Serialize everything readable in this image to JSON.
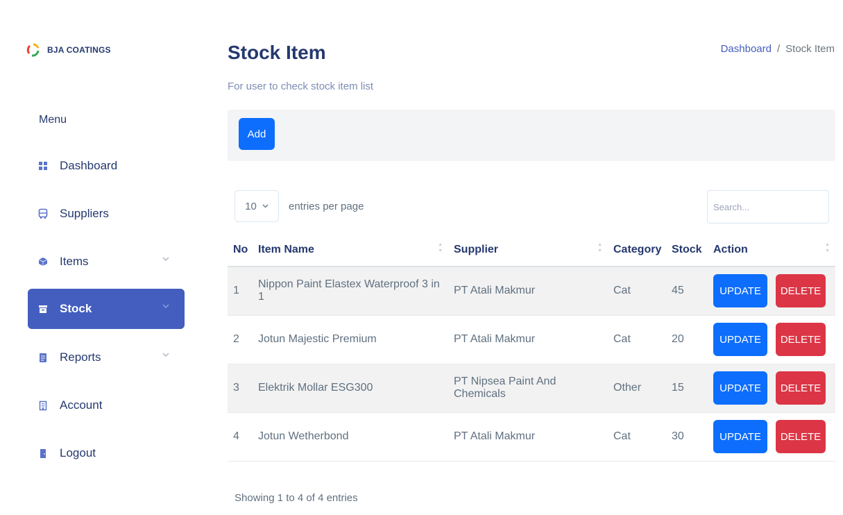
{
  "brand": {
    "name": "BJA COATINGS"
  },
  "sidebar": {
    "menu_title": "Menu",
    "items": [
      {
        "label": "Dashboard",
        "icon": "grid-icon",
        "has_submenu": false,
        "active": false
      },
      {
        "label": "Suppliers",
        "icon": "bus-icon",
        "has_submenu": false,
        "active": false
      },
      {
        "label": "Items",
        "icon": "box-icon",
        "has_submenu": true,
        "active": false
      },
      {
        "label": "Stock",
        "icon": "archive-icon",
        "has_submenu": true,
        "active": true
      },
      {
        "label": "Reports",
        "icon": "file-icon",
        "has_submenu": true,
        "active": false
      },
      {
        "label": "Account",
        "icon": "building-icon",
        "has_submenu": false,
        "active": false
      },
      {
        "label": "Logout",
        "icon": "door-icon",
        "has_submenu": false,
        "active": false
      }
    ]
  },
  "header": {
    "title": "Stock Item",
    "subtitle": "For user to check stock item list",
    "breadcrumb": {
      "link": "Dashboard",
      "separator": "/",
      "current": "Stock Item"
    }
  },
  "toolbar": {
    "add_label": "Add"
  },
  "table_controls": {
    "per_page_value": "10",
    "per_page_label": "entries per page",
    "search_placeholder": "Search..."
  },
  "table": {
    "columns": [
      "No",
      "Item Name",
      "Supplier",
      "Category",
      "Stock",
      "Action"
    ],
    "rows": [
      {
        "no": "1",
        "item_name": "Nippon Paint Elastex Waterproof 3 in 1",
        "supplier": "PT Atali Makmur",
        "category": "Cat",
        "stock": "45"
      },
      {
        "no": "2",
        "item_name": "Jotun Majestic Premium",
        "supplier": "PT Atali Makmur",
        "category": "Cat",
        "stock": "20"
      },
      {
        "no": "3",
        "item_name": "Elektrik Mollar ESG300",
        "supplier": "PT Nipsea Paint And Chemicals",
        "category": "Other",
        "stock": "15"
      },
      {
        "no": "4",
        "item_name": "Jotun Wetherbond",
        "supplier": "PT Atali Makmur",
        "category": "Cat",
        "stock": "30"
      }
    ],
    "update_label": "UPDATE",
    "delete_label": "DELETE"
  },
  "footer": {
    "info": "Showing 1 to 4 of 4 entries"
  },
  "colors": {
    "primary": "#0d6efd",
    "danger": "#dc3545",
    "sidebar_active": "#435ebe",
    "heading": "#25396f"
  }
}
